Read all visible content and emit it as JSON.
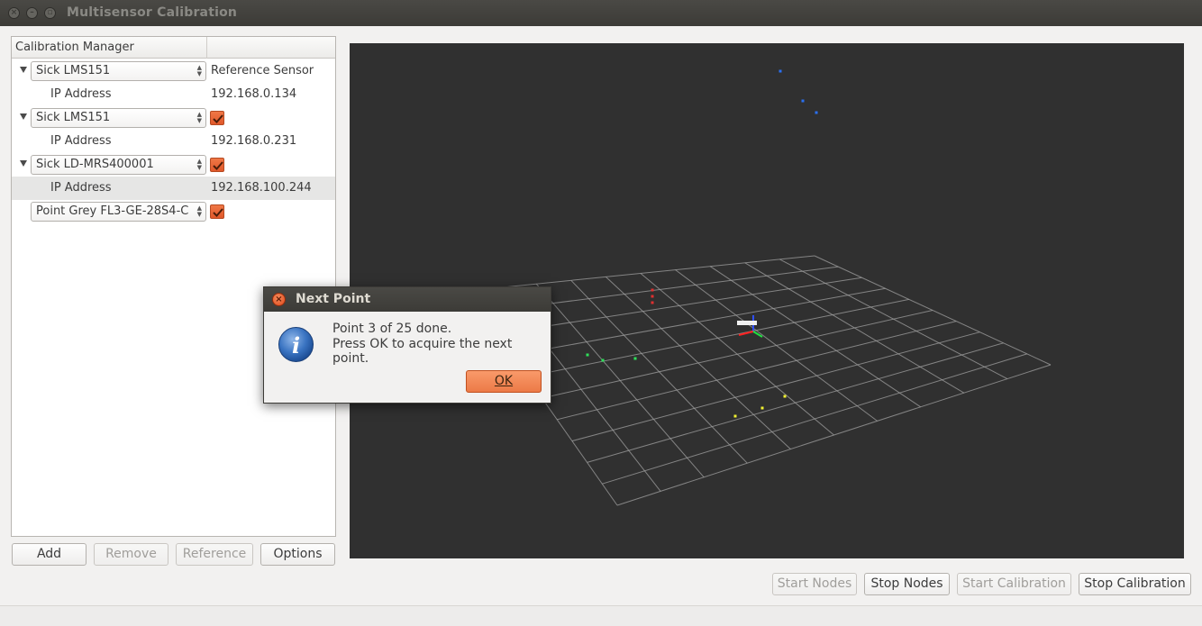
{
  "window": {
    "title": "Multisensor Calibration",
    "controls": [
      "x",
      "-",
      "□"
    ]
  },
  "tree": {
    "header": "Calibration Manager",
    "rows": [
      {
        "type": "sensor",
        "name": "Sick LMS151",
        "right": "Reference Sensor",
        "checked": false
      },
      {
        "type": "prop",
        "label": "IP Address",
        "value": "192.168.0.134"
      },
      {
        "type": "sensor",
        "name": "Sick LMS151",
        "right": "",
        "checked": true
      },
      {
        "type": "prop",
        "label": "IP Address",
        "value": "192.168.0.231"
      },
      {
        "type": "sensor",
        "name": "Sick LD-MRS400001",
        "right": "",
        "checked": true
      },
      {
        "type": "prop",
        "label": "IP Address",
        "value": "192.168.100.244",
        "selected": true
      },
      {
        "type": "sensor",
        "name": "Point Grey FL3-GE-28S4-C",
        "right": "",
        "checked": true,
        "noArrow": true
      }
    ]
  },
  "left_buttons": {
    "add": "Add",
    "remove": "Remove",
    "reference": "Reference",
    "options": "Options"
  },
  "bottom_buttons": {
    "start_nodes": "Start Nodes",
    "stop_nodes": "Stop Nodes",
    "start_calibration": "Start Calibration",
    "stop_calibration": "Stop Calibration"
  },
  "viewer": {
    "background": "#303030",
    "grid_color": "#a0a0a0",
    "point_colors": {
      "blue": "#2a6ff0",
      "green": "#2ee05a",
      "yellow": "#f0f030",
      "red": "#e03030"
    }
  },
  "dialog": {
    "title": "Next Point",
    "icon": "info-icon",
    "line1": "Point 3 of 25 done.",
    "line2": "Press OK to acquire the next point.",
    "ok": "OK"
  }
}
